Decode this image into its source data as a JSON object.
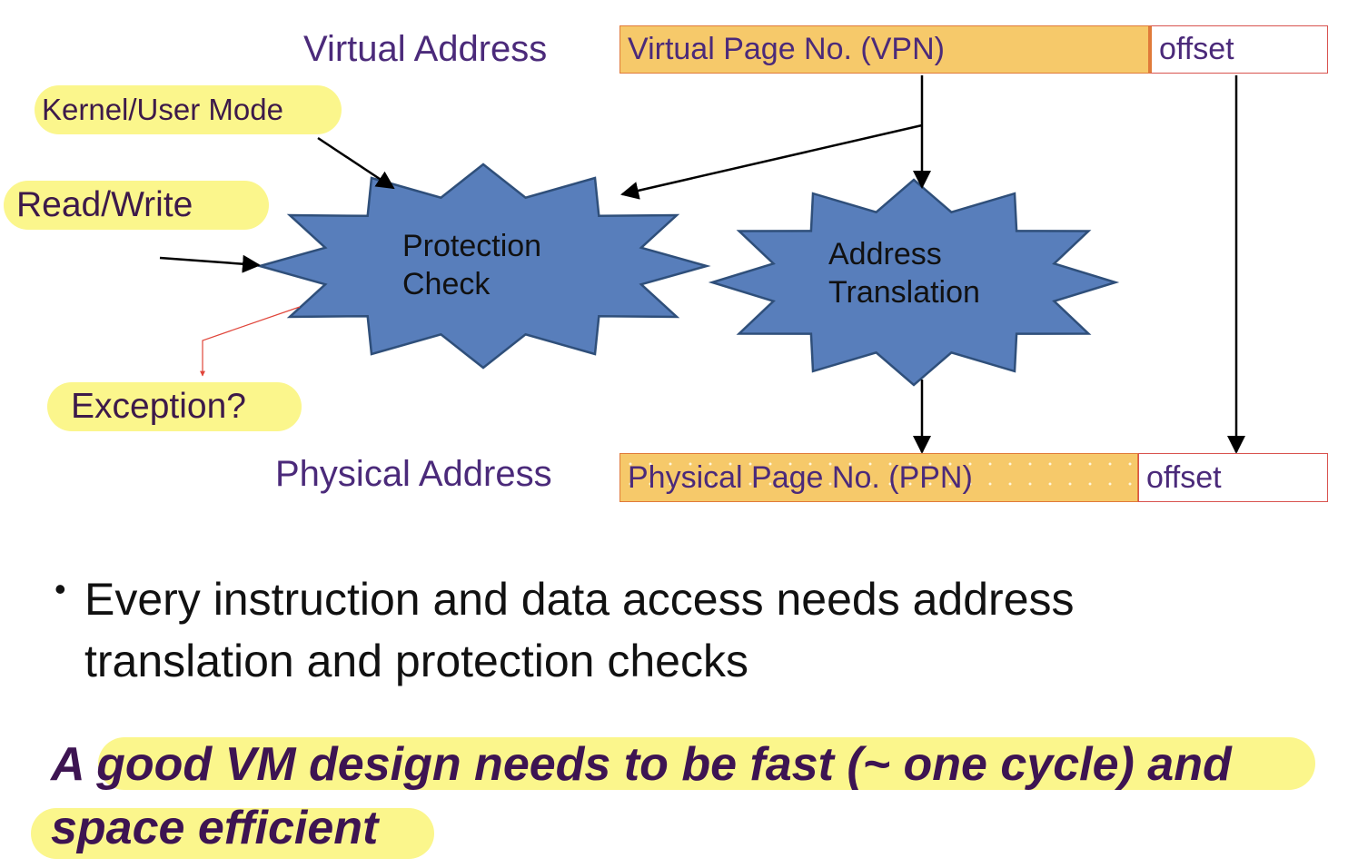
{
  "diagram": {
    "virtual_address_label": "Virtual Address",
    "physical_address_label": "Physical Address",
    "vpn_field": "Virtual Page No. (VPN)",
    "virtual_offset": "offset",
    "ppn_field": "Physical Page No. (PPN)",
    "physical_offset": "offset",
    "protection_check": [
      "Protection",
      "Check"
    ],
    "address_translation": [
      "Address",
      "Translation"
    ],
    "inputs": {
      "kernel_user_mode": "Kernel/User Mode",
      "read_write": "Read/Write",
      "exception": "Exception?"
    },
    "colors": {
      "star_fill": "#587ebb",
      "star_stroke": "#2f4f7a",
      "field_fill": "#f6c96a",
      "highlight": "#fbf68c",
      "label_purple": "#4b2a7a"
    }
  },
  "bullet": {
    "line1": "Every instruction and data access needs address",
    "line2": "translation and protection checks"
  },
  "tagline": {
    "line1_prefix": "A",
    "line1_rest": "good VM design needs to be fast (~ one cycle) and",
    "line2": "space efficient"
  }
}
